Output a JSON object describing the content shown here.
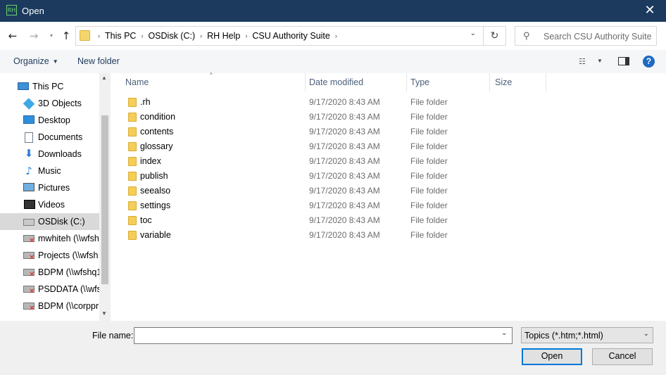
{
  "window": {
    "title": "Open",
    "app_icon_text": "RH",
    "close_glyph": "✕"
  },
  "nav": {
    "back_glyph": "←",
    "forward_glyph": "→",
    "recent_glyph": "▾",
    "up_glyph": "↑",
    "refresh_glyph": "↻",
    "address_dropdown_glyph": "⌄",
    "breadcrumbs": [
      "This PC",
      "OSDisk (C:)",
      "RH Help",
      "CSU Authority Suite"
    ],
    "breadcrumb_separator": "›",
    "search_glyph": "⚲",
    "search_placeholder": "Search CSU Authority Suite"
  },
  "toolbar": {
    "organize_label": "Organize",
    "organize_caret": "▼",
    "new_folder_label": "New folder",
    "view_glyph": "☷",
    "view_caret": "▼",
    "help_glyph": "?"
  },
  "sidebar": {
    "scroll_up": "▲",
    "scroll_down": "▼",
    "items": [
      {
        "label": "This PC",
        "icon": "computer-icon",
        "selected": false
      },
      {
        "label": "3D Objects",
        "icon": "3d-objects-icon",
        "selected": false
      },
      {
        "label": "Desktop",
        "icon": "desktop-icon",
        "selected": false
      },
      {
        "label": "Documents",
        "icon": "documents-icon",
        "selected": false
      },
      {
        "label": "Downloads",
        "icon": "downloads-icon",
        "selected": false
      },
      {
        "label": "Music",
        "icon": "music-icon",
        "selected": false
      },
      {
        "label": "Pictures",
        "icon": "pictures-icon",
        "selected": false
      },
      {
        "label": "Videos",
        "icon": "videos-icon",
        "selected": false
      },
      {
        "label": "OSDisk (C:)",
        "icon": "disk-drive-icon",
        "selected": true
      },
      {
        "label": "mwhiteh (\\\\wfsh",
        "icon": "network-drive-disconnected-icon",
        "selected": false
      },
      {
        "label": "Projects (\\\\wfsh",
        "icon": "network-drive-disconnected-icon",
        "selected": false
      },
      {
        "label": "BDPM (\\\\wfshq1",
        "icon": "network-drive-disconnected-icon",
        "selected": false
      },
      {
        "label": "PSDDATA (\\\\wfsl",
        "icon": "network-drive-disconnected-icon",
        "selected": false
      },
      {
        "label": "BDPM (\\\\corppr",
        "icon": "network-drive-disconnected-icon",
        "selected": false
      }
    ],
    "glyphs": {
      "downloads": "⬇",
      "music": "♪"
    }
  },
  "columns": {
    "name": "Name",
    "date": "Date modified",
    "type": "Type",
    "size": "Size",
    "sort_glyph": "^"
  },
  "files": [
    {
      "name": ".rh",
      "date": "9/17/2020 8:43 AM",
      "type": "File folder"
    },
    {
      "name": "condition",
      "date": "9/17/2020 8:43 AM",
      "type": "File folder"
    },
    {
      "name": "contents",
      "date": "9/17/2020 8:43 AM",
      "type": "File folder"
    },
    {
      "name": "glossary",
      "date": "9/17/2020 8:43 AM",
      "type": "File folder"
    },
    {
      "name": "index",
      "date": "9/17/2020 8:43 AM",
      "type": "File folder"
    },
    {
      "name": "publish",
      "date": "9/17/2020 8:43 AM",
      "type": "File folder"
    },
    {
      "name": "seealso",
      "date": "9/17/2020 8:43 AM",
      "type": "File folder"
    },
    {
      "name": "settings",
      "date": "9/17/2020 8:43 AM",
      "type": "File folder"
    },
    {
      "name": "toc",
      "date": "9/17/2020 8:43 AM",
      "type": "File folder"
    },
    {
      "name": "variable",
      "date": "9/17/2020 8:43 AM",
      "type": "File folder"
    }
  ],
  "bottom": {
    "file_name_label": "File name:",
    "file_name_value": "",
    "dropdown_glyph": "⌄",
    "filter_value": "Topics (*.htm;*.html)",
    "open_label": "Open",
    "cancel_label": "Cancel"
  },
  "colors": {
    "titlebar": "#1b3a5e",
    "accent": "#0078d7",
    "folder": "#f5cd57"
  }
}
